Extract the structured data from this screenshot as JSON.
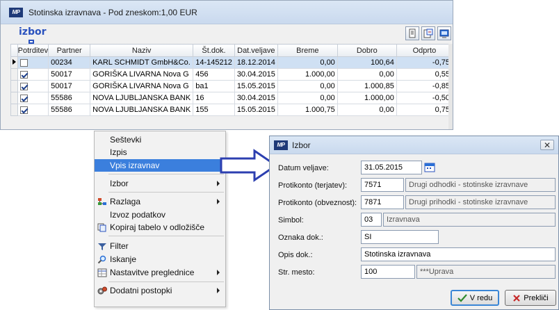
{
  "window": {
    "title": "Stotinska izravnava - Pod zneskom:1,00 EUR",
    "izbor_label": "izbor"
  },
  "grid": {
    "columns": [
      "Potrditev",
      "Partner",
      "Naziv",
      "Št.dok.",
      "Dat.veljave",
      "Breme",
      "Dobro",
      "Odprto"
    ],
    "rows": [
      {
        "checked": false,
        "partner": "00234",
        "naziv": "KARL SCHMIDT GmbH&Co.",
        "stdok": "14-145212",
        "datum": "18.12.2014",
        "breme": "0,00",
        "dobro": "100,64",
        "odprto": "-0,75",
        "selected": true
      },
      {
        "checked": true,
        "partner": "50017",
        "naziv": "GORIŠKA LIVARNA  Nova G",
        "stdok": "456",
        "datum": "30.04.2015",
        "breme": "1.000,00",
        "dobro": "0,00",
        "odprto": "0,55",
        "selected": false
      },
      {
        "checked": true,
        "partner": "50017",
        "naziv": "GORIŠKA LIVARNA  Nova G",
        "stdok": "ba1",
        "datum": "15.05.2015",
        "breme": "0,00",
        "dobro": "1.000,85",
        "odprto": "-0,85",
        "selected": false
      },
      {
        "checked": true,
        "partner": "55586",
        "naziv": "NOVA LJUBLJANSKA BANK",
        "stdok": "16",
        "datum": "30.04.2015",
        "breme": "0,00",
        "dobro": "1.000,00",
        "odprto": "-0,50",
        "selected": false
      },
      {
        "checked": true,
        "partner": "55586",
        "naziv": "NOVA LJUBLJANSKA BANK",
        "stdok": "155",
        "datum": "15.05.2015",
        "breme": "1.000,75",
        "dobro": "0,00",
        "odprto": "0,75",
        "selected": false
      }
    ]
  },
  "context_menu": {
    "items": [
      {
        "label": "Seštevki"
      },
      {
        "label": "Izpis"
      },
      {
        "label": "Vpis izravnav"
      },
      {
        "label": "Izbor"
      },
      {
        "label": "Razlaga"
      },
      {
        "label": "Izvoz podatkov"
      },
      {
        "label": "Kopiraj tabelo v odložišče"
      },
      {
        "label": "Filter"
      },
      {
        "label": "Iskanje"
      },
      {
        "label": "Nastavitve preglednice"
      },
      {
        "label": "Dodatni postopki"
      }
    ]
  },
  "dialog": {
    "title": "Izbor",
    "fields": {
      "datum_veljave": {
        "label": "Datum veljave:",
        "value": "31.05.2015"
      },
      "protikonto_terjatev": {
        "label": "Protikonto (terjatev):",
        "value": "7571",
        "desc": "Drugi odhodki - stotinske izravnave"
      },
      "protikonto_obveznost": {
        "label": "Protikonto (obveznost):",
        "value": "7871",
        "desc": "Drugi prihodki - stotinske izravnave"
      },
      "simbol": {
        "label": "Simbol:",
        "value": "03",
        "desc": "Izravnava"
      },
      "oznaka_dok": {
        "label": "Oznaka dok.:",
        "value": "SI"
      },
      "opis_dok": {
        "label": "Opis dok.:",
        "value": "Stotinska izravnava"
      },
      "str_mesto": {
        "label": "Str. mesto:",
        "value": "100",
        "desc": "***Uprava"
      }
    },
    "ok_label": "V redu",
    "cancel_label": "Prekliči"
  },
  "colors": {
    "accent": "#2a52be",
    "menu_highlight": "#3b7fdd",
    "arrow": "#2c3fb0"
  }
}
